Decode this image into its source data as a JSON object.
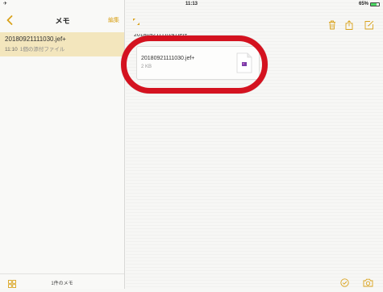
{
  "status_bar": {
    "left": "✈",
    "time": "11:13",
    "battery": "65%",
    "battery_level": 0.65
  },
  "sidebar": {
    "title": "メモ",
    "edit_label": "編集",
    "notes": [
      {
        "title": "20180921111030.jef+",
        "time": "11:10",
        "subtitle": "1個の添付ファイル"
      }
    ],
    "count_label": "1件のメモ"
  },
  "main": {
    "heading": "20180921111030.jef+",
    "attachment": {
      "name": "20180921111030.jef+",
      "size": "2 KB"
    }
  },
  "colors": {
    "accent": "#d9a21b",
    "selected_row": "#f3e6bd",
    "highlight_ring": "#d4121f"
  },
  "icons": [
    "back-chevron-icon",
    "expand-icon",
    "trash-icon",
    "share-icon",
    "compose-icon",
    "gallery-grid-icon",
    "checklist-icon",
    "camera-icon",
    "file-icon"
  ]
}
